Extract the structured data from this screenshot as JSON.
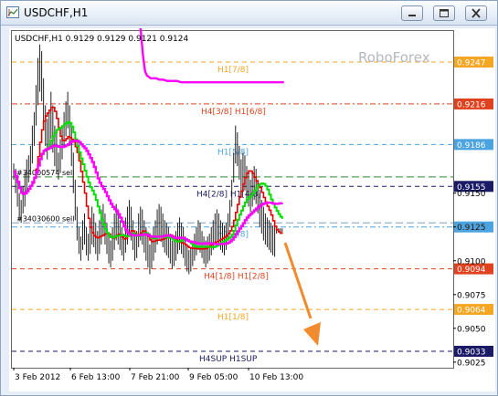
{
  "window": {
    "title": "USDCHF,H1"
  },
  "chart_data": {
    "type": "line",
    "symbol_info": "USDCHF,H1  0.9129 0.9129 0.9121 0.9124",
    "watermark": "RoboForex",
    "ylim": [
      0.9022,
      0.9175
    ],
    "y_ticks": [
      "0.9150",
      "0.9125",
      "0.9100",
      "0.9075",
      "0.9050",
      "0.9025"
    ],
    "x_ticks": [
      "3 Feb 2012",
      "6 Feb 13:00",
      "7 Feb 21:00",
      "9 Feb 05:00",
      "10 Feb 13:00"
    ],
    "levels": [
      {
        "price": 0.9247,
        "label": "H1[7/8]",
        "price_label": "0.9247",
        "color": "#f5a623",
        "style": "dash"
      },
      {
        "price": 0.9216,
        "label": "H4[3/8] H1[6/8]",
        "price_label": "0.9216",
        "color": "#e0421f",
        "style": "dashdot"
      },
      {
        "price": 0.9186,
        "label": "H1[5/8]",
        "price_label": "0.9186",
        "color": "#4ba3e0",
        "style": "dash"
      },
      {
        "price": 0.9155,
        "label": "H4[2/8] H1[4/8]",
        "price_label": "0.9155",
        "color": "#1a1a66",
        "style": "dash"
      },
      {
        "price": 0.9125,
        "label": "H1[3/8]",
        "price_label": "0.9125",
        "color": "#4ba3e0",
        "style": "dashdot"
      },
      {
        "price": 0.9094,
        "label": "H4[1/8] H1[2/8]",
        "price_label": "0.9094",
        "color": "#e0421f",
        "style": "dash"
      },
      {
        "price": 0.9064,
        "label": "H1[1/8]",
        "price_label": "0.9064",
        "color": "#f5a623",
        "style": "dash"
      },
      {
        "price": 0.9033,
        "label": "H4SUP H1SUP",
        "price_label": "0.9033",
        "color": "#1a1a66",
        "style": "dash"
      }
    ],
    "orders": [
      {
        "label": "#34000574 sell",
        "price": 0.9162
      },
      {
        "label": "#34030600 sell",
        "price": 0.9128
      }
    ],
    "series": [
      {
        "color": "#222222",
        "x": [
          0,
          2,
          4,
          6,
          8,
          10,
          12,
          14,
          16,
          18,
          20,
          22,
          24,
          26,
          28,
          30,
          32,
          34,
          36,
          38,
          40,
          42,
          44,
          46,
          48,
          50,
          52,
          54,
          56,
          58,
          60,
          62,
          64,
          66,
          68,
          70,
          72,
          74,
          76,
          78,
          80,
          82,
          84,
          86,
          88,
          90,
          92,
          94,
          96,
          98,
          100,
          102,
          104,
          106,
          108,
          110,
          112,
          114,
          116,
          118,
          120,
          122,
          124,
          126,
          128,
          130,
          132,
          134,
          136,
          138,
          140,
          142,
          144,
          146,
          148,
          150,
          152,
          154,
          156,
          158,
          160,
          162,
          164,
          166,
          168,
          170,
          172,
          174,
          176,
          178,
          180,
          182,
          184,
          186,
          188,
          190,
          192,
          194,
          196,
          198,
          200,
          202,
          204,
          206,
          208,
          210,
          212,
          214,
          216,
          218,
          220,
          222,
          224,
          226,
          228,
          230,
          232,
          234,
          236,
          238,
          240,
          242,
          244,
          246,
          248,
          250,
          252,
          254,
          256,
          258,
          260,
          262,
          264,
          266,
          268,
          270,
          272,
          274,
          276,
          278,
          280,
          282,
          284,
          286,
          288
        ],
        "high": [
          0.9172,
          0.9168,
          0.916,
          0.915,
          0.9145,
          0.9155,
          0.9165,
          0.9175,
          0.9178,
          0.9185,
          0.92,
          0.921,
          0.923,
          0.925,
          0.926,
          0.9255,
          0.9235,
          0.9215,
          0.9205,
          0.921,
          0.9225,
          0.9215,
          0.92,
          0.9195,
          0.918,
          0.919,
          0.92,
          0.921,
          0.9218,
          0.9225,
          0.9215,
          0.92,
          0.918,
          0.916,
          0.914,
          0.9125,
          0.9118,
          0.913,
          0.9135,
          0.9125,
          0.912,
          0.913,
          0.914,
          0.9135,
          0.9128,
          0.9122,
          0.913,
          0.9138,
          0.9142,
          0.9135,
          0.9128,
          0.912,
          0.9115,
          0.9125,
          0.9135,
          0.9142,
          0.9138,
          0.913,
          0.9125,
          0.912,
          0.9132,
          0.914,
          0.9145,
          0.914,
          0.913,
          0.912,
          0.9122,
          0.9135,
          0.914,
          0.9138,
          0.913,
          0.9125,
          0.9118,
          0.9112,
          0.9118,
          0.9125,
          0.913,
          0.9138,
          0.9142,
          0.914,
          0.9135,
          0.913,
          0.9128,
          0.9125,
          0.912,
          0.9115,
          0.9118,
          0.9122,
          0.9128,
          0.9132,
          0.9128,
          0.9125,
          0.9118,
          0.9112,
          0.9108,
          0.911,
          0.9115,
          0.912,
          0.9125,
          0.913,
          0.9128,
          0.9122,
          0.9118,
          0.9115,
          0.9118,
          0.912,
          0.9125,
          0.913,
          0.9135,
          0.9138,
          0.9135,
          0.913,
          0.9128,
          0.9126,
          0.9128,
          0.9135,
          0.9145,
          0.916,
          0.918,
          0.92,
          0.9195,
          0.9185,
          0.9175,
          0.918,
          0.9178,
          0.917,
          0.9165,
          0.916,
          0.9165,
          0.917,
          0.9168,
          0.916,
          0.915,
          0.9145,
          0.914,
          0.9135,
          0.9132,
          0.913,
          0.9128,
          0.9126,
          0.9125,
          0.9124,
          0.9124,
          0.9124,
          0.9124
        ],
        "low": [
          0.916,
          0.915,
          0.914,
          0.913,
          0.9128,
          0.9135,
          0.914,
          0.915,
          0.9158,
          0.9165,
          0.9172,
          0.9185,
          0.92,
          0.9215,
          0.9225,
          0.9218,
          0.92,
          0.9185,
          0.9175,
          0.9182,
          0.919,
          0.918,
          0.917,
          0.9165,
          0.916,
          0.9165,
          0.9175,
          0.9185,
          0.9192,
          0.9198,
          0.9185,
          0.917,
          0.915,
          0.913,
          0.9115,
          0.9105,
          0.91,
          0.9108,
          0.9112,
          0.9104,
          0.91,
          0.9105,
          0.9112,
          0.911,
          0.9105,
          0.91,
          0.9105,
          0.9112,
          0.9118,
          0.9112,
          0.9105,
          0.9098,
          0.9095,
          0.91,
          0.9108,
          0.9115,
          0.9112,
          0.9108,
          0.9104,
          0.91,
          0.9106,
          0.9112,
          0.9118,
          0.9115,
          0.9108,
          0.91,
          0.9102,
          0.911,
          0.9115,
          0.9112,
          0.9106,
          0.91,
          0.9095,
          0.909,
          0.9094,
          0.91,
          0.9106,
          0.9112,
          0.9116,
          0.9114,
          0.911,
          0.9106,
          0.9104,
          0.9102,
          0.9098,
          0.9094,
          0.9096,
          0.91,
          0.9105,
          0.9108,
          0.9105,
          0.9102,
          0.9096,
          0.9092,
          0.909,
          0.9092,
          0.9096,
          0.91,
          0.9104,
          0.9108,
          0.9106,
          0.9102,
          0.9098,
          0.9095,
          0.9098,
          0.91,
          0.9104,
          0.9108,
          0.9112,
          0.9115,
          0.9112,
          0.9108,
          0.9106,
          0.9104,
          0.9108,
          0.9115,
          0.9125,
          0.914,
          0.9158,
          0.9172,
          0.917,
          0.916,
          0.915,
          0.9155,
          0.9152,
          0.9145,
          0.914,
          0.9136,
          0.914,
          0.9145,
          0.9142,
          0.9135,
          0.9125,
          0.912,
          0.9115,
          0.9112,
          0.911,
          0.9108,
          0.9106,
          0.9104,
          0.9103,
          0.912,
          0.9121,
          0.9121,
          0.9121
        ]
      }
    ],
    "indicators": [
      {
        "color": "#ff00ff",
        "x": [
          131,
          131,
          133,
          135,
          137,
          139,
          141,
          143,
          145,
          147,
          149,
          150,
          153,
          156,
          160,
          165,
          170,
          175,
          180,
          185,
          190,
          195,
          200,
          205,
          210,
          215,
          220,
          225,
          230,
          235,
          240,
          245,
          250,
          255,
          260,
          265,
          270,
          275,
          280,
          285,
          290
        ],
        "y": [
          0.93,
          0.93,
          0.929,
          0.928,
          0.9265,
          0.925,
          0.924,
          0.9237,
          0.9236,
          0.9235,
          0.9235,
          0.9235,
          0.9235,
          0.9234,
          0.9234,
          0.9233,
          0.9233,
          0.9233,
          0.9232,
          0.9232,
          0.9232,
          0.9232,
          0.9232,
          0.9232,
          0.9232,
          0.9232,
          0.9232,
          0.9232,
          0.9232,
          0.9232,
          0.9232,
          0.9232,
          0.9232,
          0.9232,
          0.9232,
          0.9232,
          0.9232,
          0.9232,
          0.9232,
          0.9232,
          0.9232
        ]
      }
    ]
  }
}
